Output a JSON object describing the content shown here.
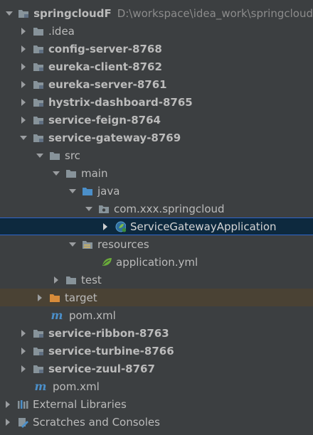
{
  "root": {
    "label": "springcloudF",
    "path": "D:\\workspace\\idea_work\\springcloud"
  },
  "items": {
    "idea": ".idea",
    "config_server": "config-server-8768",
    "eureka_client": "eureka-client-8762",
    "eureka_server": "eureka-server-8761",
    "hystrix_dashboard": "hystrix-dashboard-8765",
    "service_feign": "service-feign-8764",
    "service_gateway": "service-gateway-8769",
    "src": "src",
    "main": "main",
    "java": "java",
    "package": "com.xxx.springcloud",
    "app_class": "ServiceGatewayApplication",
    "resources": "resources",
    "application_yml": "application.yml",
    "test": "test",
    "target": "target",
    "gateway_pom": "pom.xml",
    "service_ribbon": "service-ribbon-8763",
    "service_turbine": "service-turbine-8766",
    "service_zuul": "service-zuul-8767",
    "root_pom": "pom.xml",
    "external_libraries": "External Libraries",
    "scratches": "Scratches and Consoles"
  },
  "colors": {
    "background": "#3c3f41",
    "selection": "#0d293e",
    "excluded": "#4a4234",
    "folder": "#87939a",
    "source_folder": "#4b8fc9",
    "target_folder": "#d88c3a",
    "text": "#bbbbbb"
  }
}
